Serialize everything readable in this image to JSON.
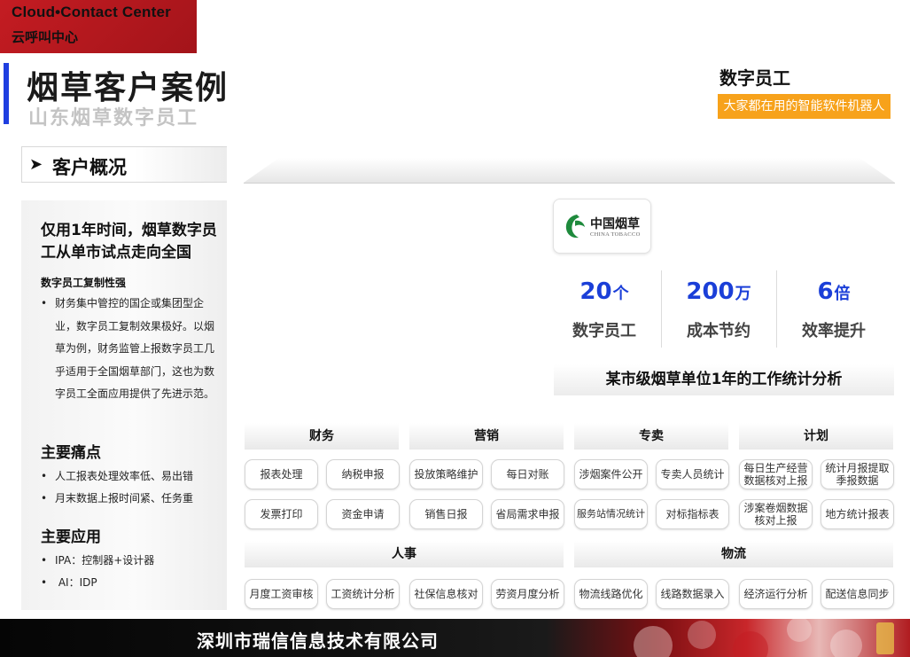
{
  "brand": {
    "name_en": "Cloud•Contact Center",
    "name_cn": "云呼叫中心"
  },
  "header": {
    "title": "烟草客户案例",
    "subtitle": "山东烟草数字员工"
  },
  "right_brand": {
    "title": "数字员工",
    "tagline": "大家都在用的智能软件机器人"
  },
  "section": {
    "label": "客户概况"
  },
  "left_panel": {
    "headline": "仅用1年时间，烟草数字员工从单市试点走向全国",
    "replicable_title": "数字员工复制性强",
    "replicable_text": "财务集中管控的国企或集团型企业，数字员工复制效果极好。以烟草为例，财务监管上报数字员工几乎适用于全国烟草部门，这也为数字员工全面应用提供了先进示范。",
    "pain_title": "主要痛点",
    "pains": [
      "人工报表处理效率低、易出错",
      "月末数据上报时间紧、任务重"
    ],
    "apps_title": "主要应用",
    "apps": [
      "IPA：控制器+设计器",
      " AI：IDP"
    ]
  },
  "logo": {
    "cn": "中国烟草",
    "en": "CHINA TOBACCO"
  },
  "stats": [
    {
      "value": "20",
      "unit": "个",
      "label": "数字员工"
    },
    {
      "value": "200",
      "unit": "万",
      "label": "成本节约"
    },
    {
      "value": "6",
      "unit": "倍",
      "label": "效率提升"
    }
  ],
  "analysis_title": "某市级烟草单位1年的工作统计分析",
  "categories": {
    "finance": {
      "label": "财务",
      "items": [
        "报表处理",
        "纳税申报",
        "发票打印",
        "资金申请"
      ]
    },
    "marketing": {
      "label": "营销",
      "items": [
        "投放策略维护",
        "每日对账",
        "销售日报",
        "省局需求申报"
      ]
    },
    "monopoly": {
      "label": "专卖",
      "items": [
        "涉烟案件公开",
        "专卖人员统计",
        "服务站情况统计",
        "对标指标表"
      ]
    },
    "plan": {
      "label": "计划",
      "items": [
        "每日生产经营数据核对上报",
        "统计月报提取季报数据",
        "涉案卷烟数据核对上报",
        "地方统计报表"
      ]
    },
    "hr": {
      "label": "人事",
      "items": [
        "月度工资审核",
        "工资统计分析",
        "社保信息核对",
        "劳资月度分析"
      ]
    },
    "logistics": {
      "label": "物流",
      "items": [
        "物流线路优化",
        "线路数据录入",
        "经济运行分析",
        "配送信息同步"
      ]
    }
  },
  "footer": {
    "company": "深圳市瑞信信息技术有限公司"
  },
  "colors": {
    "brand_red": "#c41c22",
    "accent_blue": "#1b3fd8",
    "tag_orange": "#f7a21b"
  }
}
